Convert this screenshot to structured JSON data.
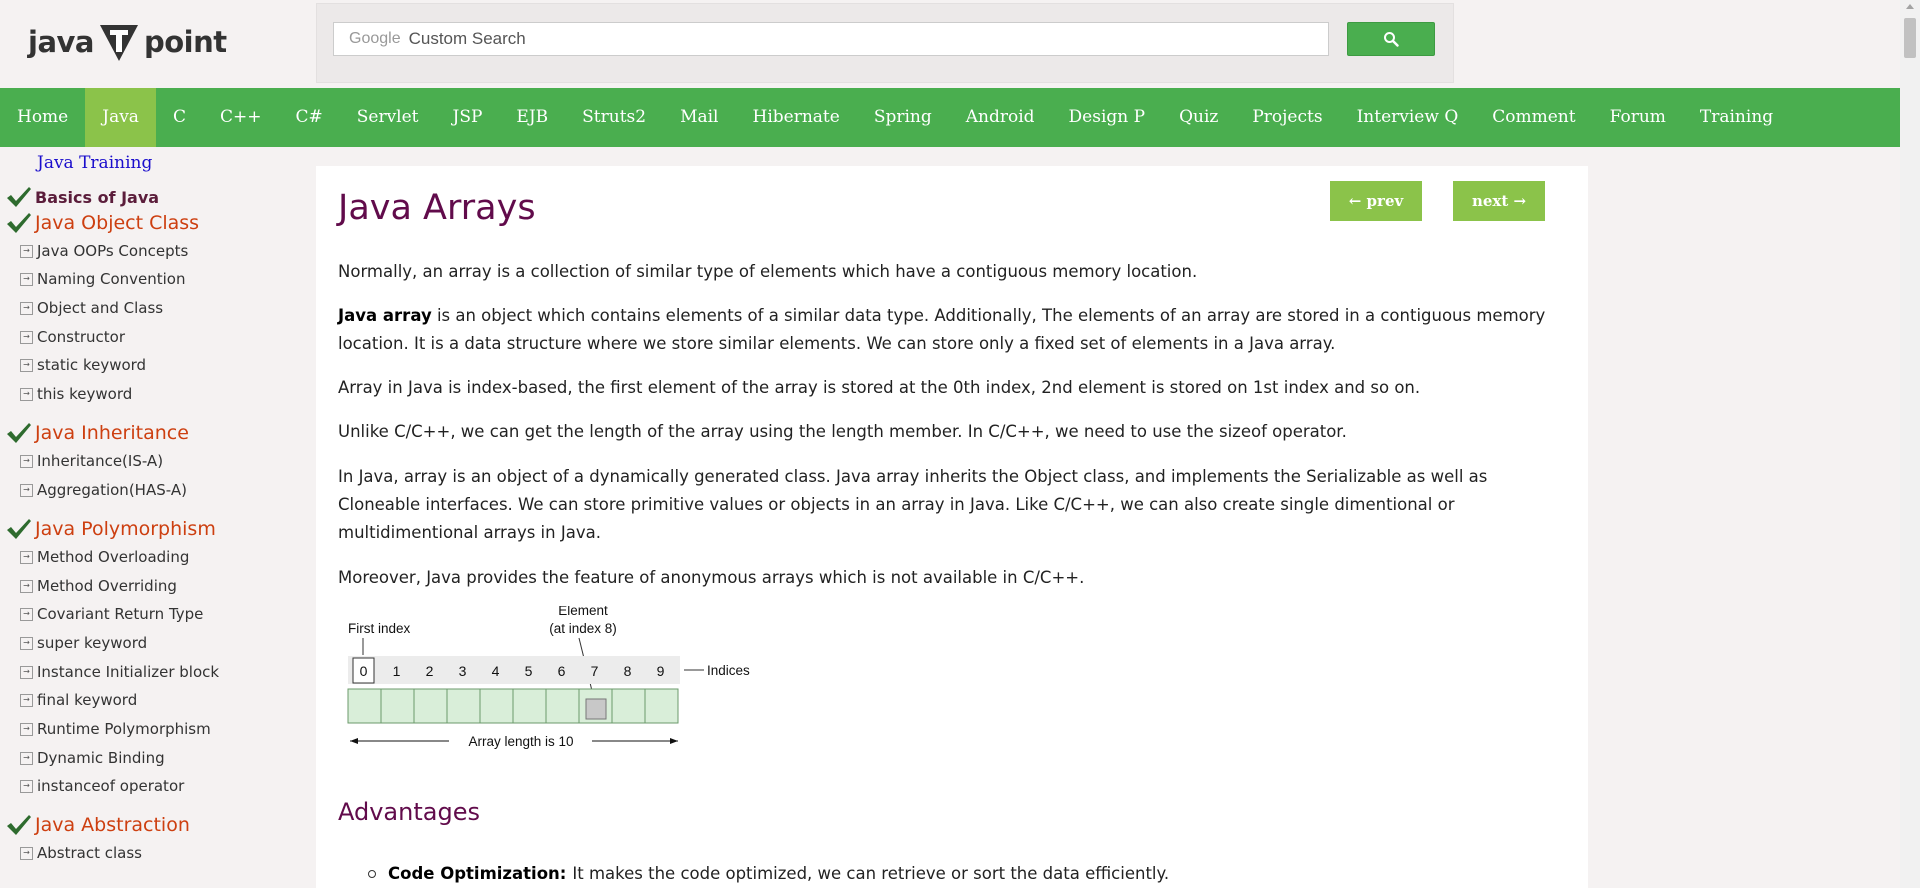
{
  "logo": {
    "left": "java",
    "right": "point"
  },
  "search": {
    "google_label": "Google",
    "placeholder": "Custom Search"
  },
  "nav": [
    "Home",
    "Java",
    "C",
    "C++",
    "C#",
    "Servlet",
    "JSP",
    "EJB",
    "Struts2",
    "Mail",
    "Hibernate",
    "Spring",
    "Android",
    "Design P",
    "Quiz",
    "Projects",
    "Interview Q",
    "Comment",
    "Forum",
    "Training"
  ],
  "nav_active": "Java",
  "sidebar": {
    "training": "Java Training",
    "basics": "Basics of Java",
    "object_class": "Java Object Class",
    "object_items": [
      "Java OOPs Concepts",
      "Naming Convention",
      "Object and Class",
      "Constructor",
      "static keyword",
      "this keyword"
    ],
    "inheritance": "Java Inheritance",
    "inheritance_items": [
      "Inheritance(IS-A)",
      "Aggregation(HAS-A)"
    ],
    "polymorphism": "Java Polymorphism",
    "polymorphism_items": [
      "Method Overloading",
      "Method Overriding",
      "Covariant Return Type",
      "super keyword",
      "Instance Initializer block",
      "final keyword",
      "Runtime Polymorphism",
      "Dynamic Binding",
      "instanceof operator"
    ],
    "abstraction": "Java Abstraction",
    "abstraction_items": [
      "Abstract class"
    ]
  },
  "content": {
    "title": "Java Arrays",
    "prev": "← prev",
    "next": "next →",
    "p1": "Normally, an array is a collection of similar type of elements which have a contiguous memory location.",
    "p2_bold": "Java array",
    "p2": " is an object which contains elements of a similar data type. Additionally, The elements of an array are stored in a contiguous memory location. It is a data structure where we store similar elements. We can store only a fixed set of elements in a Java array.",
    "p3": "Array in Java is index-based, the first element of the array is stored at the 0th index, 2nd element is stored on 1st index and so on.",
    "p4": "Unlike C/C++, we can get the length of the array using the length member. In C/C++, we need to use the sizeof operator.",
    "p5": "In Java, array is an object of a dynamically generated class. Java array inherits the Object class, and implements the Serializable as well as Cloneable interfaces. We can store primitive values or objects in an array in Java. Like C/C++, we can also create single dimentional or multidimentional arrays in Java.",
    "p6": "Moreover, Java provides the feature of anonymous arrays which is not available in C/C++.",
    "diagram": {
      "first_index": "First index",
      "element_line1": "Element",
      "element_line2": "(at index 8)",
      "indices_label": "Indices",
      "indices": [
        "0",
        "1",
        "2",
        "3",
        "4",
        "5",
        "6",
        "7",
        "8",
        "9"
      ],
      "length_label": "Array length is 10"
    },
    "advantages": "Advantages",
    "bullet_bold": "Code Optimization:",
    "bullet_text": "It makes the code optimized, we can retrieve or sort the data efficiently."
  },
  "colors": {
    "nav_bg": "#4aae4f",
    "nav_active": "#8bc34a",
    "heading": "#610b4b",
    "side_head": "#cd3f10",
    "link": "#1a0dcc",
    "check": "#2e6b2e"
  }
}
